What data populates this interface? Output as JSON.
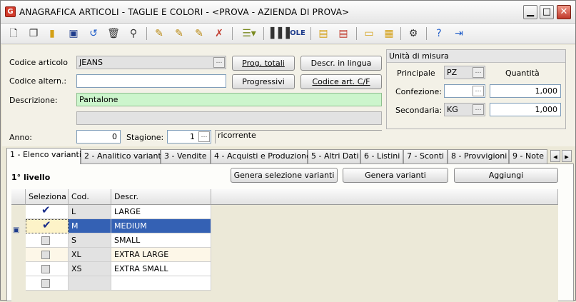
{
  "window": {
    "title": "ANAGRAFICA ARTICOLI - TAGLIE E COLORI - <PROVA - AZIENDA DI PROVA>",
    "app_icon": "app-icon"
  },
  "toolbar": {
    "icons": [
      "new-doc-icon",
      "copy-doc-icon",
      "folder-icon",
      "save-icon",
      "undo-icon",
      "delete-icon",
      "search-icon",
      "edit-icon",
      "edit2-icon",
      "edit3-icon",
      "cancel-edit-icon",
      "list-icon",
      "barcode-icon",
      "ole-icon",
      "doc1-icon",
      "doc2-icon",
      "ruler-icon",
      "tag-icon",
      "gear-icon",
      "help-icon",
      "exit-icon"
    ]
  },
  "form": {
    "codice_articolo_label": "Codice articolo",
    "codice_articolo_value": "JEANS",
    "codice_altern_label": "Codice altern.:",
    "codice_altern_value": "",
    "descrizione_label": "Descrizione:",
    "descrizione_value": "Pantalone",
    "descrizione2_value": "",
    "anno_label": "Anno:",
    "anno_value": "0",
    "stagione_label": "Stagione:",
    "stagione_value": "1",
    "stagione_desc": "ricorrente",
    "prog_totali": "Prog. totali",
    "progressivi": "Progressivi",
    "descr_lingua": "Descr. in lingua",
    "codice_cf": "Codice art. C/F"
  },
  "um": {
    "title": "Unità di misura",
    "principale_label": "Principale",
    "principale_value": "PZ",
    "quantita_label": "Quantità",
    "confezione_label": "Confezione:",
    "confezione_um": "",
    "confezione_qty": "1,000",
    "secondaria_label": "Secondaria:",
    "secondaria_um": "KG",
    "secondaria_qty": "1,000"
  },
  "tabs": [
    "1 - Elenco varianti",
    "2 - Analitico varianti",
    "3 - Vendite",
    "4 - Acquisti e Produzione",
    "5 - Altri Dati",
    "6 - Listini",
    "7 - Sconti",
    "8 - Provvigioni",
    "9 - Note"
  ],
  "panel": {
    "level_label": "1° livello",
    "btn_genera_sel": "Genera selezione varianti",
    "btn_genera": "Genera varianti",
    "btn_aggiungi": "Aggiungi"
  },
  "grid": {
    "headers": [
      "Seleziona",
      "Cod.",
      "Descr."
    ],
    "rows": [
      {
        "cod": "L",
        "descr": "LARGE",
        "checked": true
      },
      {
        "cod": "M",
        "descr": "MEDIUM",
        "checked": true
      },
      {
        "cod": "S",
        "descr": "SMALL",
        "checked": false
      },
      {
        "cod": "XL",
        "descr": "EXTRA LARGE",
        "checked": false
      },
      {
        "cod": "XS",
        "descr": "EXTRA SMALL",
        "checked": false
      },
      {
        "cod": "",
        "descr": "",
        "checked": false
      }
    ]
  },
  "colors": {
    "selection": "#3461b4",
    "green_field": "#ccf5cc",
    "title_icon": "#d23a2a"
  }
}
